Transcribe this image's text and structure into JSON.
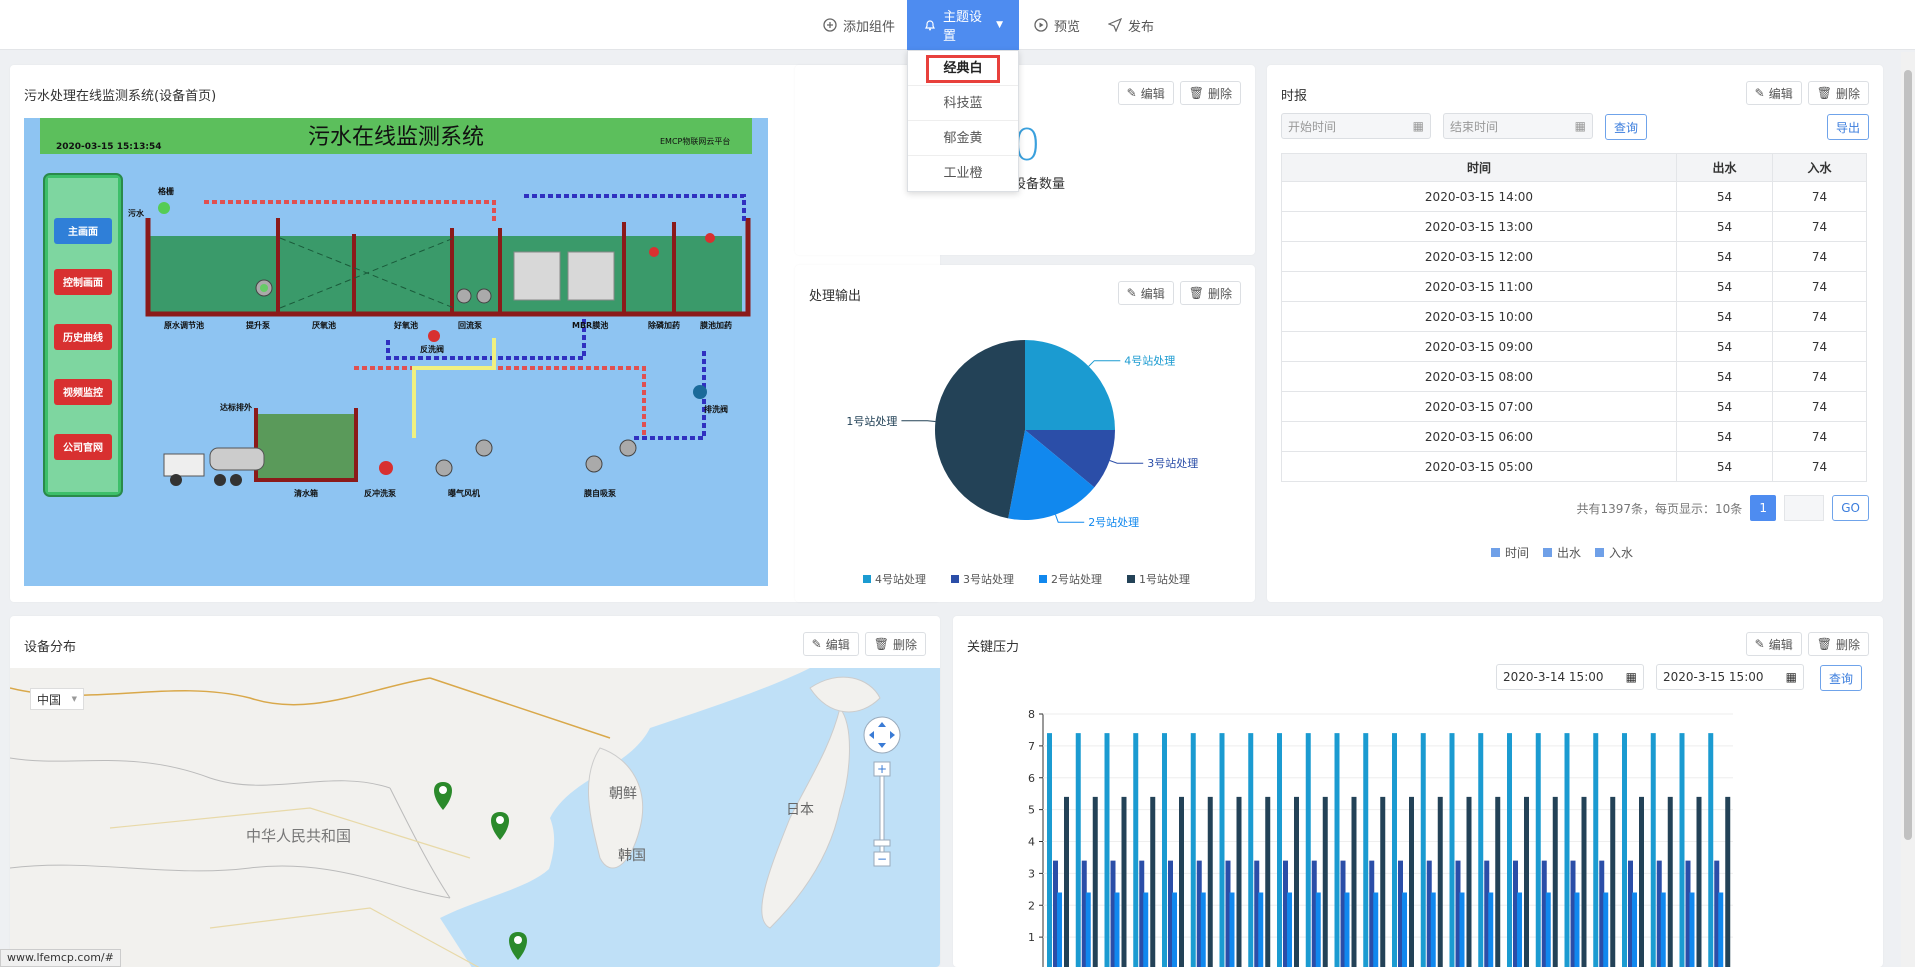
{
  "toolbar": {
    "add": "添加组件",
    "theme": "主题设置",
    "preview": "预览",
    "publish": "发布"
  },
  "theme_menu": [
    "经典白",
    "科技蓝",
    "郁金黄",
    "工业橙"
  ],
  "common": {
    "edit": "编辑",
    "delete": "删除"
  },
  "monitor": {
    "title": "污水处理在线监测系统(设备首页)",
    "screen_title": "污水在线监测系统",
    "timestamp": "2020-03-15 15:13:54",
    "platform": "EMCP物联网云平台",
    "nav": [
      "主画面",
      "控制画面",
      "历史曲线",
      "视频监控",
      "公司官网"
    ],
    "labels": [
      "原水调节池",
      "提升泵",
      "厌氧池",
      "好氧池",
      "回流泵",
      "MBR膜池",
      "除磷加药",
      "膜池加药",
      "反洗阀",
      "清水箱",
      "反冲洗泵",
      "曝气风机",
      "膜自吸泵",
      "排洗阀",
      "达标排外",
      "污水",
      "格栅"
    ]
  },
  "device_count": {
    "value": "0",
    "label": "设备数量"
  },
  "pie": {
    "title": "处理输出",
    "colors": [
      "#1b9bd1",
      "#2b4ea8",
      "#1188ee",
      "#234257"
    ]
  },
  "chart_data": [
    {
      "type": "pie",
      "labels": [
        "4号站处理",
        "3号站处理",
        "2号站处理",
        "1号站处理"
      ],
      "values": [
        25,
        11,
        17,
        47
      ],
      "legend": "bottom"
    },
    {
      "type": "bar",
      "ylim": [
        0,
        8
      ],
      "yticks": [
        1,
        2,
        3,
        4,
        5,
        6,
        7,
        8
      ],
      "groups": 24,
      "series": [
        {
          "values": [
            7.4,
            7.4,
            7.4,
            7.4,
            7.4,
            7.4,
            7.4,
            7.4,
            7.4,
            7.4,
            7.4,
            7.4,
            7.4,
            7.4,
            7.4,
            7.4,
            7.4,
            7.4,
            7.4,
            7.4,
            7.4,
            7.4,
            7.4,
            7.4
          ]
        },
        {
          "values": [
            3.4,
            3.4,
            3.4,
            3.4,
            3.4,
            3.4,
            3.4,
            3.4,
            3.4,
            3.4,
            3.4,
            3.4,
            3.4,
            3.4,
            3.4,
            3.4,
            3.4,
            3.4,
            3.4,
            3.4,
            3.4,
            3.4,
            3.4,
            3.4
          ]
        },
        {
          "values": [
            2.4,
            2.4,
            2.4,
            2.4,
            2.4,
            2.4,
            2.4,
            2.4,
            2.4,
            2.4,
            2.4,
            2.4,
            2.4,
            2.4,
            2.4,
            2.4,
            2.4,
            2.4,
            2.4,
            2.4,
            2.4,
            2.4,
            2.4,
            2.4
          ]
        },
        {
          "values": [
            5.4,
            5.4,
            5.4,
            5.4,
            5.4,
            5.4,
            5.4,
            5.4,
            5.4,
            5.4,
            5.4,
            5.4,
            5.4,
            5.4,
            5.4,
            5.4,
            5.4,
            5.4,
            5.4,
            5.4,
            5.4,
            5.4,
            5.4,
            5.4
          ]
        }
      ],
      "colors": [
        "#1b9bd1",
        "#2b4ea8",
        "#1188ee",
        "#234257"
      ]
    }
  ],
  "report": {
    "title": "时报",
    "start_placeholder": "开始时间",
    "end_placeholder": "结束时间",
    "query": "查询",
    "export": "导出",
    "headers": [
      "时间",
      "出水",
      "入水"
    ],
    "rows": [
      [
        "2020-03-15 14:00",
        "54",
        "74"
      ],
      [
        "2020-03-15 13:00",
        "54",
        "74"
      ],
      [
        "2020-03-15 12:00",
        "54",
        "74"
      ],
      [
        "2020-03-15 11:00",
        "54",
        "74"
      ],
      [
        "2020-03-15 10:00",
        "54",
        "74"
      ],
      [
        "2020-03-15 09:00",
        "54",
        "74"
      ],
      [
        "2020-03-15 08:00",
        "54",
        "74"
      ],
      [
        "2020-03-15 07:00",
        "54",
        "74"
      ],
      [
        "2020-03-15 06:00",
        "54",
        "74"
      ],
      [
        "2020-03-15 05:00",
        "54",
        "74"
      ]
    ],
    "pager_text": "共有1397条，每页显示：10条",
    "page": "1",
    "go": "GO",
    "legend": [
      "时间",
      "出水",
      "入水"
    ]
  },
  "map": {
    "title": "设备分布",
    "select": "中国",
    "labels": [
      "中华人民共和国",
      "朝鲜",
      "韩国",
      "日本"
    ]
  },
  "pressure": {
    "title": "关键压力",
    "start": "2020-3-14 15:00",
    "end": "2020-3-15 15:00",
    "query": "查询"
  },
  "status_url": "www.lfemcp.com/#"
}
